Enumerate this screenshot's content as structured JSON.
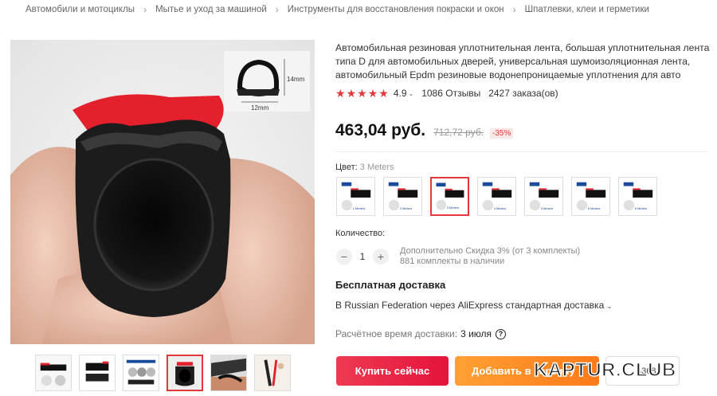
{
  "breadcrumb": [
    "Автомобили и мотоциклы",
    "Мытье и уход за машиной",
    "Инструменты для восстановления покраски и окон",
    "Шпатлевки, клеи и герметики"
  ],
  "image_labels": {
    "height": "14mm",
    "width": "12mm"
  },
  "product": {
    "title": "Автомобильная резиновая уплотнительная лента, большая уплотнительная лента типа D для автомобильных дверей, универсальная шумоизоляционная лента, автомобильный Epdm резиновые водонепроницаемые уплотнения для авто",
    "rating": "4.9",
    "reviews": "1086 Отзывы",
    "orders": "2427 заказа(ов)",
    "price": "463,04 руб.",
    "old_price": "712,72 руб.",
    "discount": "-35%"
  },
  "color": {
    "label": "Цвет:",
    "selected": "3 Meters",
    "variants": [
      "1 Meters",
      "2 Meters",
      "3 Meters",
      "4 Meters",
      "5 Meters",
      "6 Meters",
      "8 Meters"
    ],
    "active_index": 2
  },
  "quantity": {
    "label": "Количество:",
    "minus": "−",
    "plus": "+",
    "value": "1",
    "discount_note": "Дополнительно Скидка 3% (от 3 комплекты)",
    "stock": "881 комплекты в наличии"
  },
  "shipping": {
    "title": "Бесплатная доставка",
    "method": "В Russian Federation через AliExpress стандартная доставка",
    "date_label": "Расчётное время доставки:",
    "date_value": "3 июля",
    "help_icon": "?"
  },
  "actions": {
    "buy": "Купить сейчас",
    "cart": "Добавить в корзину",
    "wish_count": "4368"
  },
  "watermark": "KAPTUR.CLUB",
  "icons": {
    "star": "star-icon",
    "chevron": "chevron-down-icon",
    "help": "question-circle-icon",
    "heart": "heart-icon"
  },
  "colors": {
    "accent": "#e4393c",
    "buy_button": "#ee3a51",
    "cart_button": "#ff8a1f"
  }
}
